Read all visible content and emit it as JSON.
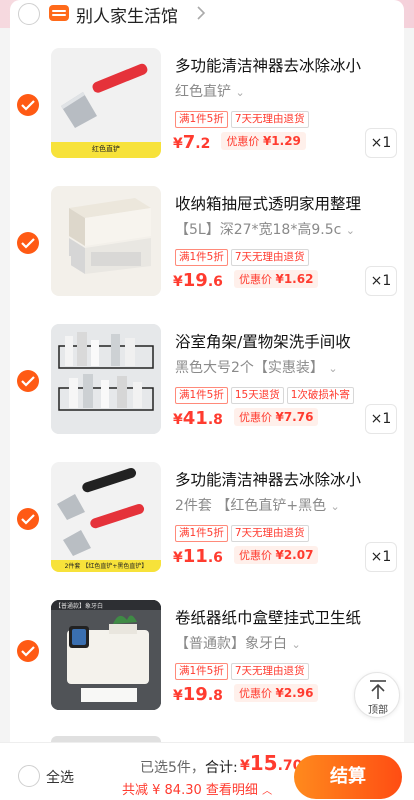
{
  "shop": {
    "name": "别人家生活馆"
  },
  "items": [
    {
      "title": "多功能清洁神器去冰除冰小",
      "spec": "红色直铲",
      "tags": [
        "满1件5折",
        "7天无理由退货"
      ],
      "price_currency": "¥",
      "price_int": "7",
      "price_dec": ".2",
      "promo_label": "优惠价",
      "promo_value": "¥1.29",
      "qty": "×1",
      "thumb_caption": "红色直铲"
    },
    {
      "title": "收纳箱抽屉式透明家用整理",
      "spec": "【5L】深27*宽18*高9.5c",
      "tags": [
        "满1件5折",
        "7天无理由退货"
      ],
      "price_currency": "¥",
      "price_int": "19",
      "price_dec": ".6",
      "promo_label": "优惠价",
      "promo_value": "¥1.62",
      "qty": "×1",
      "thumb_caption": ""
    },
    {
      "title": "浴室角架/置物架洗手间收",
      "spec": "黑色大号2个【实惠装】",
      "tags": [
        "满1件5折",
        "15天退货",
        "1次破损补寄"
      ],
      "price_currency": "¥",
      "price_int": "41",
      "price_dec": ".8",
      "promo_label": "优惠价",
      "promo_value": "¥7.76",
      "qty": "×1",
      "thumb_caption": ""
    },
    {
      "title": "多功能清洁神器去冰除冰小",
      "spec": "2件套 【红色直铲+黑色",
      "tags": [
        "满1件5折",
        "7天无理由退货"
      ],
      "price_currency": "¥",
      "price_int": "11",
      "price_dec": ".6",
      "promo_label": "优惠价",
      "promo_value": "¥2.07",
      "qty": "×1",
      "thumb_caption": "2件套 【红色直铲+黑色直铲】"
    },
    {
      "title": "卷纸器纸巾盒壁挂式卫生纸",
      "spec": "【普通款】象牙白",
      "tags": [
        "满1件5折",
        "7天无理由退货"
      ],
      "price_currency": "¥",
      "price_int": "19",
      "price_dec": ".8",
      "promo_label": "优惠价",
      "promo_value": "¥2.96",
      "qty": "",
      "thumb_caption": "【普通款】象牙白"
    }
  ],
  "to_top": {
    "label": "顶部"
  },
  "bottom": {
    "select_all": "全选",
    "selected_text": "已选5件，",
    "total_label": "合计:",
    "total_currency": "¥",
    "total_int": "15",
    "total_dec": ".70",
    "save_text": "共减 ¥ 84.30",
    "detail_link": "查看明细",
    "checkout": "结算"
  },
  "colors": {
    "accent": "#ff5a14",
    "price": "#ff3b2f"
  }
}
